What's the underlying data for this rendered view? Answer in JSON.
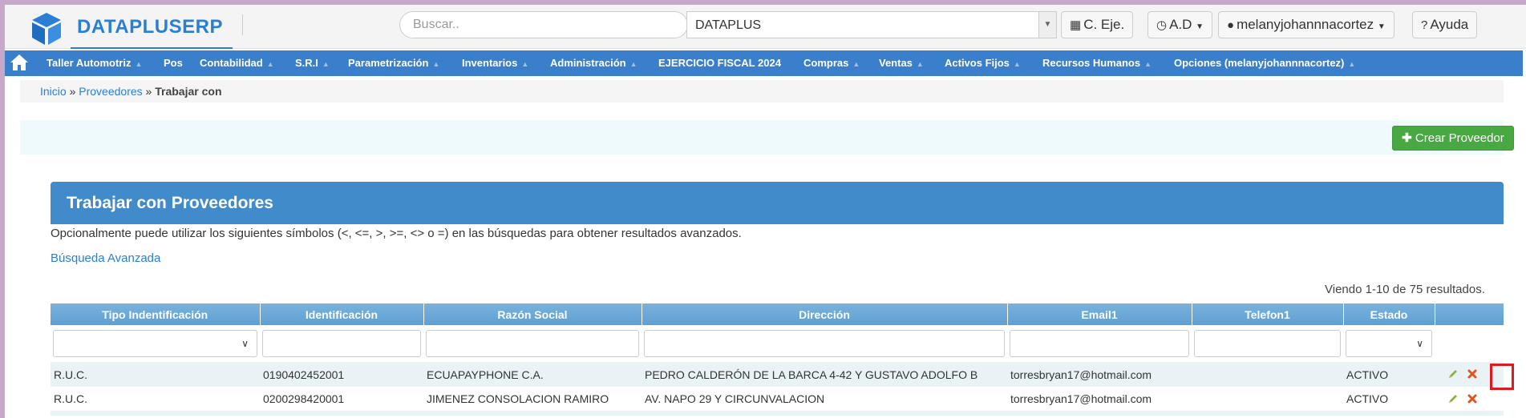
{
  "header": {
    "brand": "DATAPLUSERP",
    "search_placeholder": "Buscar..",
    "company_value": "DATAPLUS",
    "buttons": {
      "fiscal": "C. Eje.",
      "ad": "A.D",
      "user": "melanyjohannnacortez",
      "help": "Ayuda"
    }
  },
  "nav": {
    "items": [
      "Taller Automotriz",
      "Pos",
      "Contabilidad",
      "S.R.I",
      "Parametrización",
      "Inventarios",
      "Administración",
      "EJERCICIO FISCAL 2024",
      "Compras",
      "Ventas",
      "Activos Fijos",
      "Recursos Humanos",
      "Opciones (melanyjohannnacortez)"
    ]
  },
  "breadcrumb": {
    "home": "Inicio",
    "section": "Proveedores",
    "current": "Trabajar con"
  },
  "actions": {
    "create": "Crear Proveedor"
  },
  "panel": {
    "title": "Trabajar con Proveedores",
    "hint": "Opcionalmente puede utilizar los siguientes símbolos (<, <=, >, >=, <> o =) en las búsquedas para obtener resultados avanzados.",
    "advanced": "Búsqueda Avanzada",
    "summary": "Viendo 1-10 de 75 resultados."
  },
  "table": {
    "columns": [
      "Tipo Indentificación",
      "Identificación",
      "Razón Social",
      "Dirección",
      "Email1",
      "Telefon1",
      "Estado",
      ""
    ],
    "rows": [
      {
        "tipo": "R.U.C.",
        "id": "0190402452001",
        "razon": "ECUAPAYPHONE C.A.",
        "direccion": "PEDRO CALDERÓN DE LA BARCA 4-42 Y GUSTAVO ADOLFO B",
        "email": "torresbryan17@hotmail.com",
        "telefono": "",
        "estado": "ACTIVO"
      },
      {
        "tipo": "R.U.C.",
        "id": "0200298420001",
        "razon": "JIMENEZ CONSOLACION RAMIRO",
        "direccion": "AV. NAPO 29 Y CIRCUNVALACION",
        "email": "torresbryan17@hotmail.com",
        "telefono": "",
        "estado": "ACTIVO"
      }
    ]
  },
  "colors": {
    "brand": "#2a7fd4",
    "nav": "#3a7fcb",
    "panel": "#428bca",
    "create_button": "#48a842",
    "highlight": "#e0191f"
  }
}
